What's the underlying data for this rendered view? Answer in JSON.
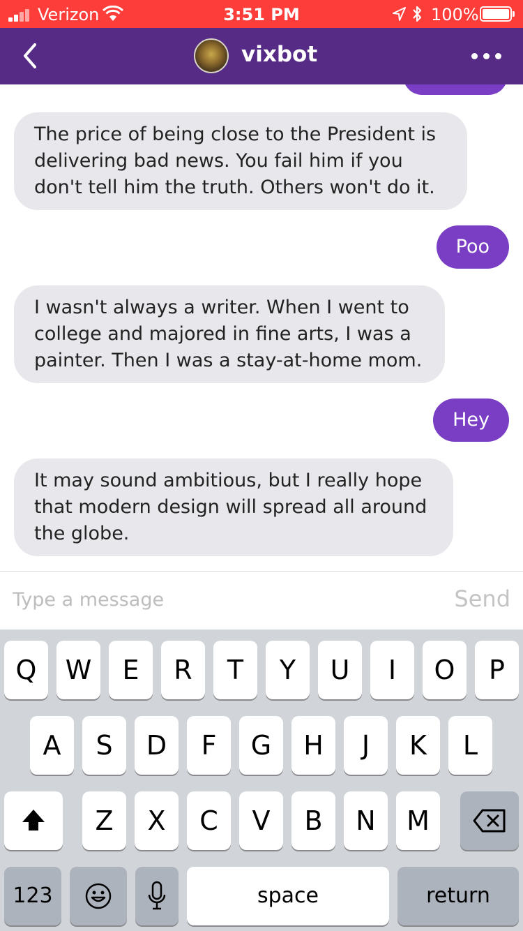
{
  "status_bar": {
    "carrier": "Verizon",
    "time": "3:51 PM",
    "battery": "100%"
  },
  "nav": {
    "back_icon": "chevron-left-icon",
    "title": "vixbot",
    "more_icon": "more-dots-icon"
  },
  "messages": [
    {
      "from": "bot",
      "text": "The price of being close to the President is delivering bad news. You fail him if you don't tell him the truth. Others won't do it."
    },
    {
      "from": "user",
      "text": "Poo"
    },
    {
      "from": "bot",
      "text": "I wasn't always a writer. When I went to college and majored in fine arts, I was a painter. Then I was a stay-at-home mom."
    },
    {
      "from": "user",
      "text": "Hey"
    },
    {
      "from": "bot",
      "text": "It may sound ambitious, but I really hope that modern design will spread all around the globe."
    }
  ],
  "composer": {
    "placeholder": "Type a message",
    "send_label": "Send"
  },
  "keyboard": {
    "row1": [
      "Q",
      "W",
      "E",
      "R",
      "T",
      "Y",
      "U",
      "I",
      "O",
      "P"
    ],
    "row2": [
      "A",
      "S",
      "D",
      "F",
      "G",
      "H",
      "J",
      "K",
      "L"
    ],
    "row3": [
      "Z",
      "X",
      "C",
      "V",
      "B",
      "N",
      "M"
    ],
    "numbers_label": "123",
    "space_label": "space",
    "return_label": "return"
  },
  "colors": {
    "status_bar": "#fc3d39",
    "nav_bar": "#562b86",
    "user_bubble": "#7a3ec4",
    "bot_bubble": "#e8e7eb"
  }
}
